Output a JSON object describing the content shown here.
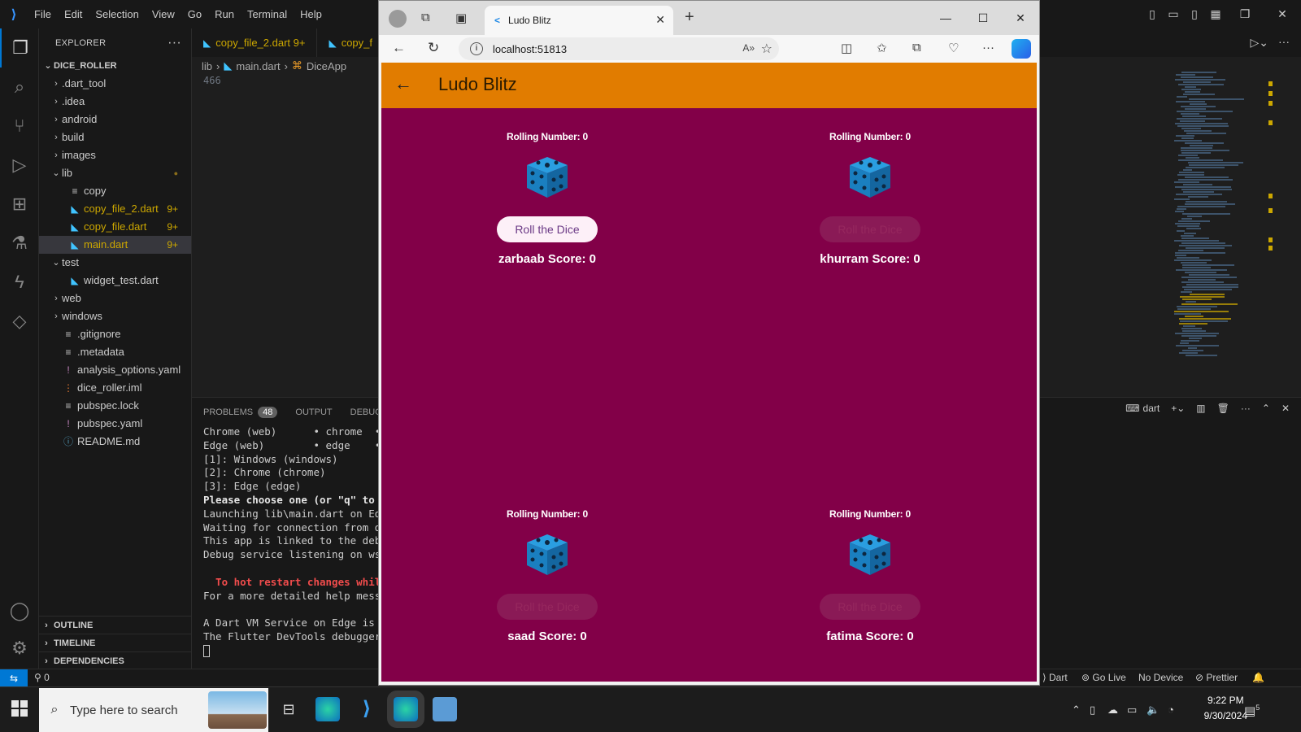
{
  "vscode": {
    "menu": [
      "File",
      "Edit",
      "Selection",
      "View",
      "Go",
      "Run",
      "Terminal",
      "Help"
    ],
    "explorer_title": "EXPLORER",
    "project": "DICE_ROLLER",
    "tree": [
      {
        "label": ".dart_tool",
        "type": "folder",
        "indent": 1
      },
      {
        "label": ".idea",
        "type": "folder",
        "indent": 1
      },
      {
        "label": "android",
        "type": "folder",
        "indent": 1
      },
      {
        "label": "build",
        "type": "folder",
        "indent": 1
      },
      {
        "label": "images",
        "type": "folder",
        "indent": 1
      },
      {
        "label": "lib",
        "type": "folder-open",
        "indent": 1,
        "warn": true
      },
      {
        "label": "copy",
        "type": "file",
        "indent": 2
      },
      {
        "label": "copy_file_2.dart",
        "type": "dart",
        "indent": 2,
        "badge": "9+"
      },
      {
        "label": "copy_file.dart",
        "type": "dart",
        "indent": 2,
        "badge": "9+"
      },
      {
        "label": "main.dart",
        "type": "dart",
        "indent": 2,
        "badge": "9+",
        "selected": true
      },
      {
        "label": "test",
        "type": "folder-open",
        "indent": 1
      },
      {
        "label": "widget_test.dart",
        "type": "dart",
        "indent": 2
      },
      {
        "label": "web",
        "type": "folder",
        "indent": 1
      },
      {
        "label": "windows",
        "type": "folder",
        "indent": 1
      },
      {
        "label": ".gitignore",
        "type": "file",
        "indent": 1
      },
      {
        "label": ".metadata",
        "type": "file",
        "indent": 1
      },
      {
        "label": "analysis_options.yaml",
        "type": "yaml",
        "indent": 1
      },
      {
        "label": "dice_roller.iml",
        "type": "iml",
        "indent": 1
      },
      {
        "label": "pubspec.lock",
        "type": "file",
        "indent": 1
      },
      {
        "label": "pubspec.yaml",
        "type": "yaml",
        "indent": 1
      },
      {
        "label": "README.md",
        "type": "info",
        "indent": 1
      }
    ],
    "sections": [
      "OUTLINE",
      "TIMELINE",
      "DEPENDENCIES"
    ],
    "tabs": [
      {
        "label": "copy_file_2.dart 9+"
      },
      {
        "label": "copy_f"
      }
    ],
    "breadcrumb": [
      "lib",
      "main.dart",
      "DiceApp"
    ],
    "line_number": "466",
    "panel_tabs": {
      "problems": "PROBLEMS",
      "problems_count": "48",
      "output": "OUTPUT",
      "debug": "DEBUG C"
    },
    "terminal_name": "dart",
    "terminal_lines": [
      {
        "text": "Chrome (web)      • chrome  • w",
        "style": "normal"
      },
      {
        "text": "Edge (web)        • edge    • w",
        "style": "normal"
      },
      {
        "text": "[1]: Windows (windows)",
        "style": "normal"
      },
      {
        "text": "[2]: Chrome (chrome)",
        "style": "normal"
      },
      {
        "text": "[3]: Edge (edge)",
        "style": "normal"
      },
      {
        "text": "Please choose one (or \"q\" to qu",
        "style": "bold"
      },
      {
        "text": "Launching lib\\main.dart on Edge",
        "style": "normal"
      },
      {
        "text": "Waiting for connection from deb",
        "style": "normal"
      },
      {
        "text": "This app is linked to the debug",
        "style": "normal"
      },
      {
        "text": "Debug service listening on ws:/",
        "style": "normal"
      },
      {
        "text": "",
        "style": "normal"
      },
      {
        "text": "  To hot restart changes while",
        "style": "red"
      },
      {
        "text": "For a more detailed help messag",
        "style": "normal"
      },
      {
        "text": "",
        "style": "normal"
      },
      {
        "text": "A Dart VM Service on Edge is av",
        "style": "normal"
      },
      {
        "text": "The Flutter DevTools debugger a",
        "style": "normal"
      }
    ],
    "status": {
      "ports": "0",
      "lang": "Dart",
      "golive": "Go Live",
      "device": "No Device",
      "prettier": "Prettier"
    }
  },
  "browser": {
    "tab_title": "Ludo Blitz",
    "url": "localhost:51813"
  },
  "app": {
    "title": "Ludo Blitz",
    "players": [
      {
        "rolling_label": "Rolling Number: 0",
        "button_label": "Roll the Dice",
        "score_label": "zarbaab Score: 0",
        "active": true
      },
      {
        "rolling_label": "Rolling Number: 0",
        "button_label": "Roll the Dice",
        "score_label": "khurram Score: 0",
        "active": false
      },
      {
        "rolling_label": "Rolling Number: 0",
        "button_label": "Roll the Dice",
        "score_label": "saad Score: 0",
        "active": false
      },
      {
        "rolling_label": "Rolling Number: 0",
        "button_label": "Roll the Dice",
        "score_label": "fatima Score: 0",
        "active": false
      }
    ],
    "colors": {
      "appbar": "#e17c00",
      "background": "#820048",
      "dice": "#1a8fd0"
    }
  },
  "taskbar": {
    "search_placeholder": "Type here to search",
    "time": "9:22 PM",
    "date": "9/30/2024",
    "notifications": "5"
  }
}
